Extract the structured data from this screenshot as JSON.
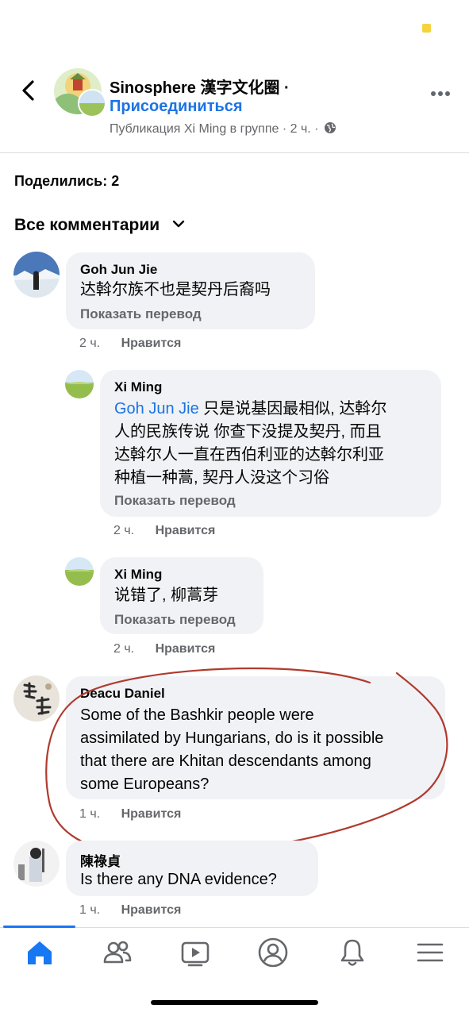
{
  "header": {
    "group_name": "Sinosphere 漢字文化圈 ·",
    "join_label": "Присоединиться",
    "post_meta": "Публикация Xi Ming в группе · 2 ч. ·"
  },
  "shares": "Поделились: 2",
  "comments_filter": "Все комментарии",
  "comments": [
    {
      "author": "Goh Jun Jie",
      "text": "达斡尔族不也是契丹后裔吗",
      "translate": "Показать перевод",
      "time": "2 ч.",
      "like": "Нравится"
    },
    {
      "author": "Xi Ming",
      "mention": "Goh Jun Jie",
      "text_line1": " 只是说基因最相似, 达斡尔",
      "text_line2": "人的民族传说 你查下没提及契丹, 而且",
      "text_line3": "达斡尔人一直在西伯利亚的达斡尔利亚",
      "text_line4": "种植一种蒿, 契丹人没这个习俗",
      "translate": "Показать перевод",
      "time": "2 ч.",
      "like": "Нравится"
    },
    {
      "author": "Xi Ming",
      "text": "说错了, 柳蒿芽",
      "translate": "Показать перевод",
      "time": "2 ч.",
      "like": "Нравится"
    },
    {
      "author": "Deacu Daniel",
      "text_line1": "Some of the Bashkir people were",
      "text_line2": "assimilated by Hungarians, do is it possible",
      "text_line3": "that there are Khitan descendants among",
      "text_line4": "some Europeans?",
      "time": "1 ч.",
      "like": "Нравится"
    },
    {
      "author": "陳祿貞",
      "text": "Is there any DNA evidence?",
      "time": "1 ч.",
      "like": "Нравится"
    }
  ],
  "tabs": [
    "home-icon",
    "friends-icon",
    "watch-icon",
    "profile-icon",
    "notifications-icon",
    "menu-icon"
  ],
  "colors": {
    "accent": "#1877f2",
    "link": "#1b74e4",
    "bubble": "#f0f2f5",
    "annotation": "#b03a2e"
  }
}
